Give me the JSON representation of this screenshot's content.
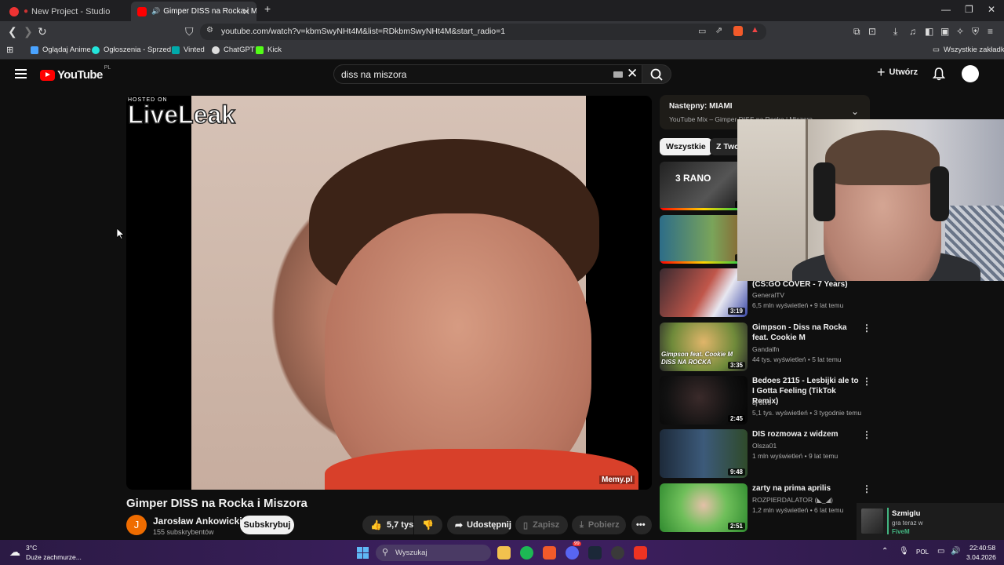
{
  "tabs": [
    {
      "title": "New Project - Studio"
    },
    {
      "title": "Gimper DISS na Rocka i Miszo"
    }
  ],
  "address": {
    "url": "youtube.com/watch?v=kbmSwyNHt4M&list=RDkbmSwyNHt4M&start_radio=1"
  },
  "bookmarks": {
    "items": [
      "Oglądaj Anime",
      "Ogłoszenia - Sprzed...",
      "Vinted",
      "ChatGPT",
      "Kick"
    ],
    "all_label": "Wszystkie zakładki"
  },
  "header": {
    "logo_text": "YouTube",
    "country": "PL",
    "search_value": "diss na miszora",
    "create_label": "Utwórz"
  },
  "player": {
    "watermark_small": "HOSTED ON",
    "watermark_big": "LiveLeak",
    "corner_watermark": "Memy.pl"
  },
  "video": {
    "title": "Gimper DISS na Rocka i Miszora",
    "channel_initial": "J",
    "channel_name": "Jarosław Ankowicki",
    "channel_subs": "155 subskrybentów",
    "subscribe_label": "Subskrybuj",
    "likes": "5,7 tys.",
    "share_label": "Udostępnij",
    "save_label": "Zapisz",
    "download_label": "Pobierz"
  },
  "up_next": {
    "title": "Następny: MIAMI",
    "subtitle": "YouTube Mix – Gimper DISS na Rocka i Miszora"
  },
  "chips": [
    "Wszystkie",
    "Z Twoi"
  ],
  "recommendations": [
    {
      "title": "",
      "channel": "",
      "meta": "",
      "duration": "2:",
      "thumb_text": "3 RANO"
    },
    {
      "title": "",
      "channel": "",
      "meta": "",
      "duration": "1:",
      "thumb_text": ""
    },
    {
      "title": "(CS:GO COVER - 7 Years)",
      "channel": "GeneralTV",
      "meta": "6,5 mln wyświetleń • 9 lat temu",
      "duration": "3:19",
      "thumb_text": ""
    },
    {
      "title": "Gimpson - Diss na Rocka feat. Cookie M",
      "channel": "Gandalfn",
      "meta": "44 tys. wyświetleń • 5 lat temu",
      "duration": "3:35",
      "thumb_text": "Gimpson feat. Cookie M DISS NA ROCKA"
    },
    {
      "title": "Bedoes 2115 - Lesbijki ale to I Gotta Feeling (TikTok Remix)",
      "channel": "dj stvs",
      "meta": "5,1 tys. wyświetleń • 3 tygodnie temu",
      "duration": "2:45",
      "thumb_text": ""
    },
    {
      "title": "DIS rozmowa z widzem",
      "channel": "Olsza01",
      "meta": "1 mln wyświetleń • 9 lat temu",
      "duration": "9:48",
      "thumb_text": ""
    },
    {
      "title": "zarty na prima aprilis",
      "channel": "ROZPIERDALATOR (◣_◢)",
      "meta": "1,2 mln wyświetleń • 6 lat temu",
      "duration": "2:51",
      "thumb_text": ""
    }
  ],
  "notification": {
    "name": "Szmiglu",
    "activity": "gra teraz w",
    "game": "FiveM"
  },
  "taskbar": {
    "temp": "3°C",
    "weather_desc": "Duże zachmurze...",
    "search_label": "Wyszukaj",
    "lang": "POL",
    "time": "22:40:58",
    "date": "3.04.2026",
    "badge": "99"
  },
  "colors": {
    "yt_red": "#ff0000",
    "bg": "#0f0f0f",
    "taskbar": "#3a1f5c"
  }
}
